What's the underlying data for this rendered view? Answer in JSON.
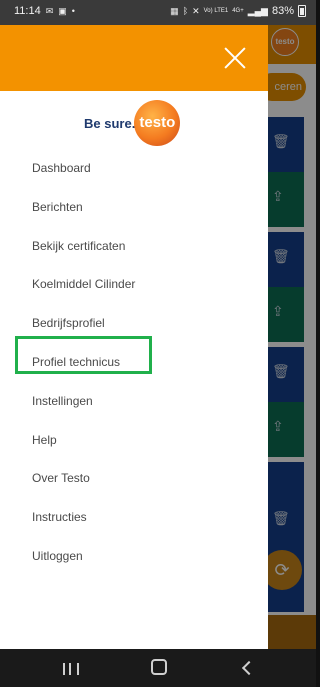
{
  "status_bar": {
    "time": "11:14",
    "left_icons": [
      "message-icon",
      "picture-icon",
      "alert-icon"
    ],
    "right_icons": [
      "sim-icon",
      "bluetooth-icon",
      "mute-icon",
      "volte-icon",
      "4g-icon",
      "signal-icon",
      "signal-icon"
    ],
    "volte_label": "Vo) LTE1",
    "network_label": "4G+",
    "battery": "83%"
  },
  "drawer": {
    "header_color": "#f39200",
    "close_icon": "close-icon",
    "brand": {
      "slogan": "Be sure.",
      "logo_text": "testo"
    },
    "menu_items": [
      {
        "label": "Dashboard"
      },
      {
        "label": "Berichten"
      },
      {
        "label": "Bekijk certificaten"
      },
      {
        "label": "Koelmiddel Cilinder"
      },
      {
        "label": "Bedrijfsprofiel"
      },
      {
        "label": "Profiel technicus"
      },
      {
        "label": "Instellingen"
      },
      {
        "label": "Help"
      },
      {
        "label": "Over Testo"
      },
      {
        "label": "Instructies"
      },
      {
        "label": "Uitloggen"
      }
    ],
    "selected_item": "Profiel technicus",
    "highlight_color": "#20b04b"
  },
  "background_app": {
    "header_logo_text": "testo",
    "pill_text": "ceren",
    "card_icons": [
      "trash-icon",
      "share-icon",
      "trash-icon",
      "share-icon",
      "trash-icon",
      "share-icon",
      "trash-icon"
    ],
    "fab_icon": "refresh-icon",
    "colors": {
      "blue": "#143e8a",
      "green": "#0c6e53",
      "orange": "#e58f00"
    }
  },
  "nav_bar": {
    "buttons": [
      "recent-apps-icon",
      "home-icon",
      "back-icon"
    ]
  }
}
